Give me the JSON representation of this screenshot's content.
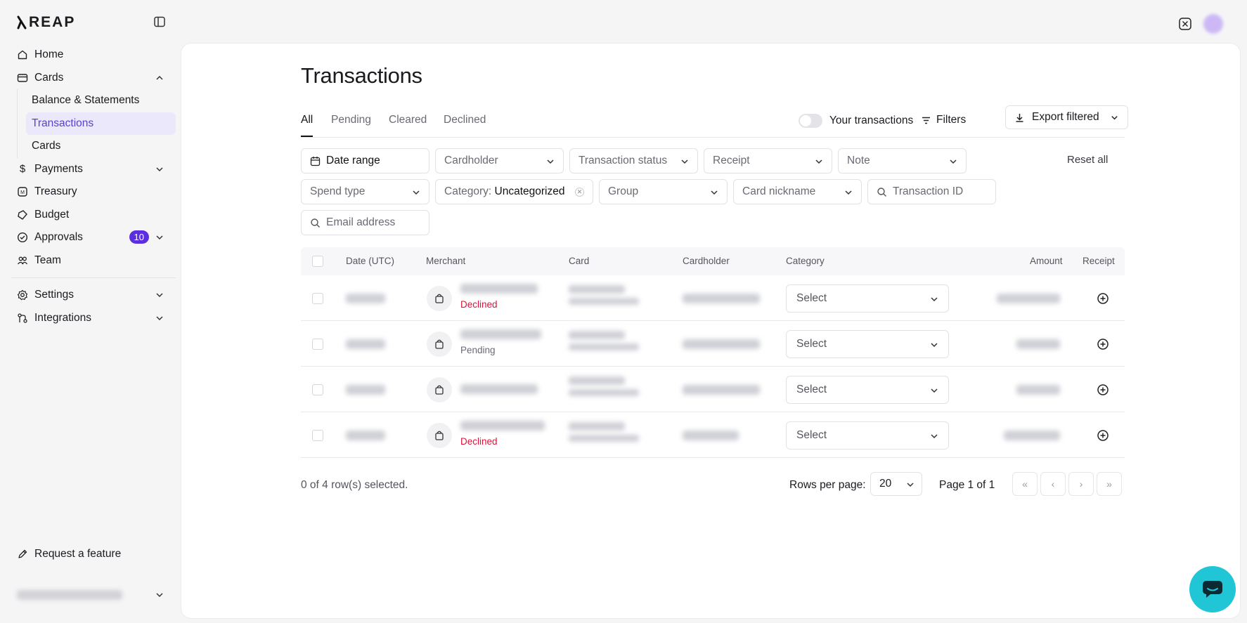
{
  "brand": {
    "logo_text": "REAP"
  },
  "sidebar": {
    "items": [
      {
        "label": "Home",
        "icon": "home-icon"
      },
      {
        "label": "Cards",
        "icon": "card-icon",
        "expanded": true
      },
      {
        "label": "Payments",
        "icon": "dollar-icon"
      },
      {
        "label": "Treasury",
        "icon": "treasury-icon"
      },
      {
        "label": "Budget",
        "icon": "budget-icon"
      },
      {
        "label": "Approvals",
        "icon": "check-circle-icon",
        "badge": "10"
      },
      {
        "label": "Team",
        "icon": "team-icon"
      },
      {
        "label": "Settings",
        "icon": "gear-icon"
      },
      {
        "label": "Integrations",
        "icon": "integrations-icon"
      }
    ],
    "cards_sub": [
      {
        "label": "Balance & Statements"
      },
      {
        "label": "Transactions",
        "active": true
      },
      {
        "label": "Cards"
      }
    ],
    "request_feature": "Request a feature"
  },
  "page": {
    "title": "Transactions"
  },
  "tabs": [
    "All",
    "Pending",
    "Cleared",
    "Declined"
  ],
  "toolbar": {
    "your_transactions": "Your transactions",
    "filters": "Filters",
    "export": "Export filtered"
  },
  "filters": {
    "date_range": "Date range",
    "cardholder": "Cardholder",
    "transaction_status": "Transaction status",
    "receipt": "Receipt",
    "note": "Note",
    "reset_all": "Reset all",
    "spend_type": "Spend type",
    "category_label": "Category:",
    "category_value": "Uncategorized",
    "group": "Group",
    "card_nickname": "Card nickname",
    "transaction_id_placeholder": "Transaction ID",
    "email_placeholder": "Email address"
  },
  "table": {
    "columns": [
      "Date (UTC)",
      "Merchant",
      "Card",
      "Cardholder",
      "Category",
      "Amount",
      "Receipt"
    ],
    "rows": [
      {
        "status": "Declined",
        "category": "Select"
      },
      {
        "status": "Pending",
        "category": "Select"
      },
      {
        "status": "",
        "category": "Select"
      },
      {
        "status": "Declined",
        "category": "Select"
      }
    ]
  },
  "pagination": {
    "selected": "0 of 4 row(s) selected.",
    "rows_per_page_label": "Rows per page:",
    "rows_per_page": "20",
    "page_label": "Page 1 of 1"
  },
  "colors": {
    "accent": "#5b2fe0",
    "declined": "#e0113a",
    "help": "#20c5d6"
  }
}
